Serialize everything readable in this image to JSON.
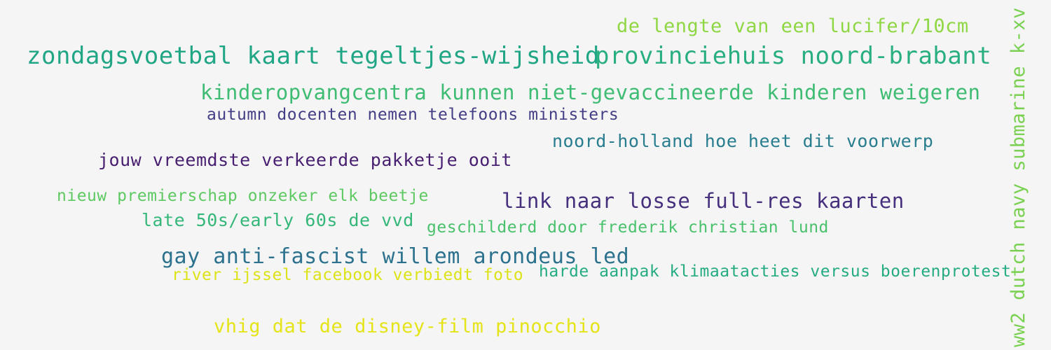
{
  "words": [
    {
      "text": "de lengte van een lucifer/10cm",
      "color": "#8fd744"
    },
    {
      "text": "zondagsvoetbal kaart tegeltjes-wijsheid",
      "color": "#21a685"
    },
    {
      "text": "provinciehuis noord-brabant",
      "color": "#29af7f"
    },
    {
      "text": "kinderopvangcentra kunnen niet-gevaccineerde kinderen weigeren",
      "color": "#3fbc73"
    },
    {
      "text": "autumn docenten nemen telefoons ministers",
      "color": "#433e85"
    },
    {
      "text": "noord-holland hoe heet dit voorwerp",
      "color": "#287d8e"
    },
    {
      "text": "jouw vreemdste verkeerde pakketje ooit",
      "color": "#481f70"
    },
    {
      "text": "nieuw premierschap onzeker elk beetje",
      "color": "#5ec962"
    },
    {
      "text": "link naar losse full-res kaarten",
      "color": "#46307e"
    },
    {
      "text": "late 50s/early 60s de vvd",
      "color": "#35b779"
    },
    {
      "text": "geschilderd door frederik christian lund",
      "color": "#4ac16d"
    },
    {
      "text": "gay anti-fascist willem arondeus led",
      "color": "#2c728e"
    },
    {
      "text": "river ijssel facebook verbiedt foto",
      "color": "#dde318"
    },
    {
      "text": "harde aanpak klimaatacties versus boerenprotest",
      "color": "#25ab82"
    },
    {
      "text": "vhig dat de disney-film pinocchio",
      "color": "#e5e419"
    },
    {
      "text": "ww2 dutch navy submarine k-xv",
      "color": "#7ad151"
    }
  ]
}
